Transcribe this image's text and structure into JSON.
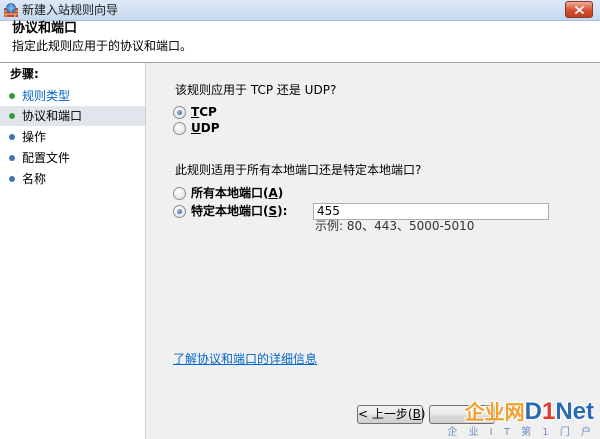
{
  "window": {
    "title": "新建入站规则向导",
    "app_icon": "firewall-icon",
    "close_icon": "close-icon"
  },
  "header": {
    "title": "协议和端口",
    "subtitle": "指定此规则应用于的协议和端口。"
  },
  "steps": {
    "heading": "步骤:",
    "items": [
      {
        "label": "规则类型",
        "completed": true,
        "current": false
      },
      {
        "label": "协议和端口",
        "completed": false,
        "current": true
      },
      {
        "label": "操作",
        "completed": false,
        "current": false
      },
      {
        "label": "配置文件",
        "completed": false,
        "current": false
      },
      {
        "label": "名称",
        "completed": false,
        "current": false
      }
    ]
  },
  "protocol": {
    "question": "该规则应用于 TCP 还是 UDP?",
    "options": [
      {
        "mnemonic": "T",
        "rest": "CP",
        "selected": true
      },
      {
        "mnemonic": "U",
        "rest": "DP",
        "selected": false
      }
    ]
  },
  "ports": {
    "question": "此规则适用于所有本地端口还是特定本地端口?",
    "options": [
      {
        "prefix": "所有本地端口(",
        "mnemonic": "A",
        "suffix": ")",
        "selected": false
      },
      {
        "prefix": "特定本地端口(",
        "mnemonic": "S",
        "suffix": "):",
        "selected": true
      }
    ],
    "specific_value": "455",
    "example": "示例: 80、443、5000-5010"
  },
  "help_link": "了解协议和端口的详细信息",
  "buttons": {
    "back": {
      "prefix": "< 上一步(",
      "mnemonic": "B",
      "suffix": ")"
    }
  },
  "watermark": {
    "brand_cn": "企业网",
    "brand_d": "D",
    "brand_1": "1",
    "brand_net": "Net",
    "tagline": "企 业 I T 第 1 门 户"
  },
  "colors": {
    "title_bar": "#c6d9ef",
    "close_button": "#d5502f",
    "link": "#0066cc",
    "bullet_done": "#2f9e3a",
    "bullet_pending": "#3f72b8",
    "current_step_bg": "#e1e6ec",
    "content_bg": "#f0f0f0",
    "brand_orange": "#f39a1e",
    "brand_blue": "#1b5fb0",
    "brand_red": "#e02a20",
    "brand_tag": "#5f86bf"
  }
}
